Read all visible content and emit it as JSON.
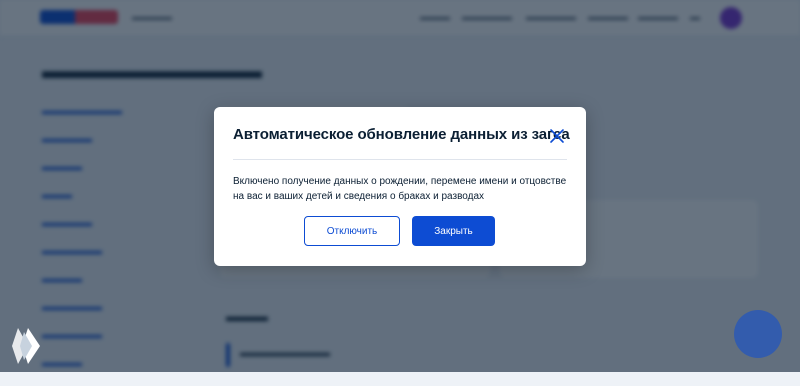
{
  "modal": {
    "title": "Автоматическое обновление данных из загса",
    "text": "Включено получение данных о рождении, перемене имени и отцовстве на вас и ваших детей и сведения о браках и разводах",
    "disable_label": "Отключить",
    "close_label": "Закрыть"
  },
  "colors": {
    "primary": "#0d4cd3",
    "overlay": "rgba(11,31,51,0.62)",
    "text": "#0b1f33"
  },
  "icons": [
    "close-icon",
    "gosuslugi-logo-icon",
    "chat-bubble-icon"
  ]
}
